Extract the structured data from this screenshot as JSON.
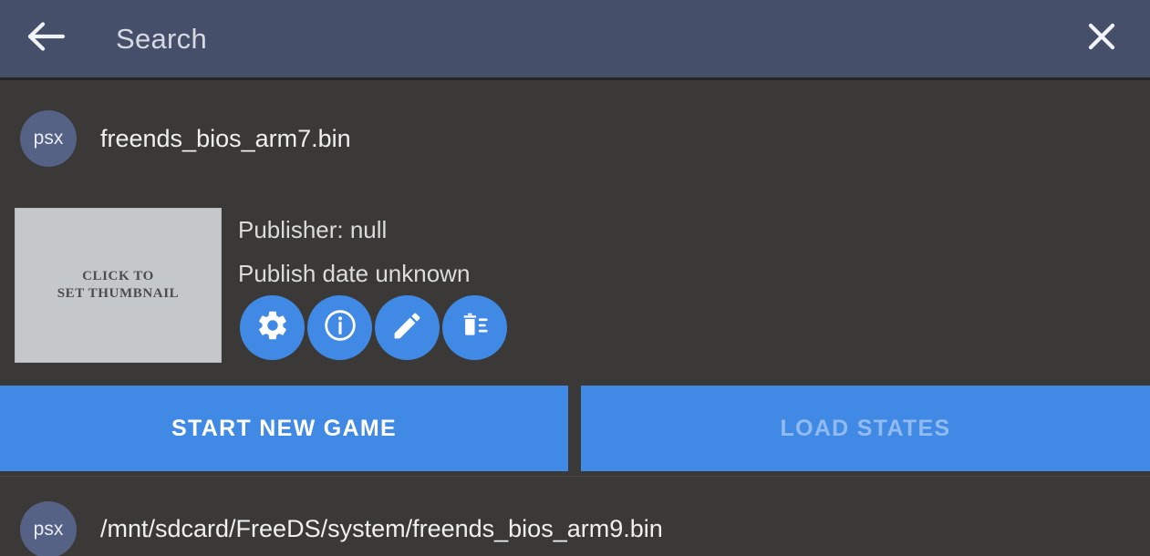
{
  "header": {
    "title": "Search",
    "back_icon": "arrow-left-icon",
    "close_icon": "close-icon",
    "bg_color": "#454f69"
  },
  "colors": {
    "background": "#3a3937",
    "accent_blue": "#4089e5",
    "badge_blue": "#566285",
    "thumbnail_placeholder": "#c5c8cb"
  },
  "entries": [
    {
      "badge": "psx",
      "label": "freends_bios_arm7.bin",
      "expanded": true
    },
    {
      "badge": "psx",
      "label": "/mnt/sdcard/FreeDS/system/freends_bios_arm9.bin",
      "expanded": false
    }
  ],
  "detail": {
    "thumbnail": {
      "line1": "CLICK TO",
      "line2": "SET THUMBNAIL"
    },
    "publisher": "Publisher: null",
    "publish_date": "Publish date unknown",
    "actions": [
      {
        "name": "settings-button",
        "icon": "gear-icon"
      },
      {
        "name": "info-button",
        "icon": "info-circle-icon"
      },
      {
        "name": "edit-button",
        "icon": "pencil-icon"
      },
      {
        "name": "delete-button",
        "icon": "trash-list-icon"
      }
    ]
  },
  "buttons": {
    "start_new_game": "START NEW GAME",
    "load_states": "LOAD STATES",
    "load_states_enabled": false
  }
}
